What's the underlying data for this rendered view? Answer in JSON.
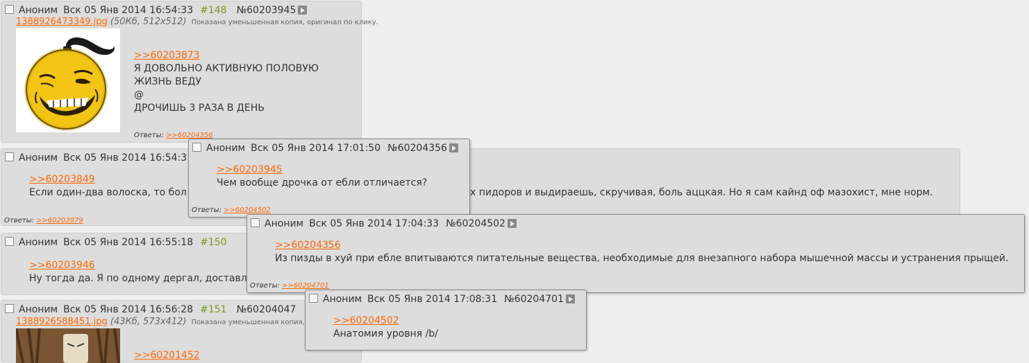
{
  "posts": [
    {
      "name": "Аноним",
      "date": "Вск 05 Янв 2014 16:54:33",
      "ordinal": "#148",
      "number": "№60203945",
      "file": {
        "name": "1388926473349.jpg",
        "meta": "(50Кб, 512x512)",
        "note": "Показана уменьшенная копия, оригинал по клику."
      },
      "lines": [
        ">>60203873",
        "Я ДОВОЛЬНО АКТИВНУЮ ПОЛОВУЮ",
        "ЖИЗНЬ ВЕДУ",
        "@",
        "ДРОЧИШЬ 3 РАЗА В ДЕНЬ"
      ],
      "replies_label": "Ответы:",
      "replies": [
        ">>60204356"
      ]
    },
    {
      "name": "Аноним",
      "date": "Вск 05 Янв 2014 16:54:3",
      "lines": [
        ">>60203849",
        "Если один-два волоска, то бол",
        "х пидоров и выдираешь, скручивая, боль аццкая. Но я сам кайнд оф мазохист, мне норм."
      ],
      "replies_label": "Ответы:",
      "replies": [
        ">>60203979"
      ]
    },
    {
      "name": "Аноним",
      "date": "Вск 05 Янв 2014 16:55:18",
      "ordinal": "#150",
      "lines": [
        ">>60203946",
        "Ну тогда да. Я по одному дергал, доставля"
      ]
    },
    {
      "name": "Аноним",
      "date": "Вск 05 Янв 2014 16:56:28",
      "ordinal": "#151",
      "number": "№60204047",
      "file": {
        "name": "1388926588451.jpg",
        "meta": "(43Кб, 573x412)",
        "note": "Показана уменьшенная копия, ориг"
      },
      "lines": [
        ">>60201452"
      ]
    }
  ],
  "popups": [
    {
      "name": "Аноним",
      "date": "Вск 05 Янв 2014 17:01:50",
      "number": "№60204356",
      "lines": [
        ">>60203945",
        "Чем вообще дрочка от ебли отличается?"
      ],
      "replies_label": "Ответы:",
      "replies": [
        ">>60204502"
      ]
    },
    {
      "name": "Аноним",
      "date": "Вск 05 Янв 2014 17:04:33",
      "number": "№60204502",
      "lines": [
        ">>60204356",
        "Из пизды в хуй при ебле впитываются питательные вещества, необходимые для внезапного набора мышечной массы и устранения прыщей."
      ],
      "replies_label": "Ответы:",
      "replies": [
        ">>60204701"
      ]
    },
    {
      "name": "Аноним",
      "date": "Вск 05 Янв 2014 17:08:31",
      "number": "№60204701",
      "lines": [
        ">>60204502",
        "Анатомия уровня /b/"
      ]
    }
  ],
  "colors": {
    "link": "#ff6600",
    "ordinal": "#789922",
    "post_bg": "#dddddd",
    "page_bg": "#eeeeee"
  }
}
